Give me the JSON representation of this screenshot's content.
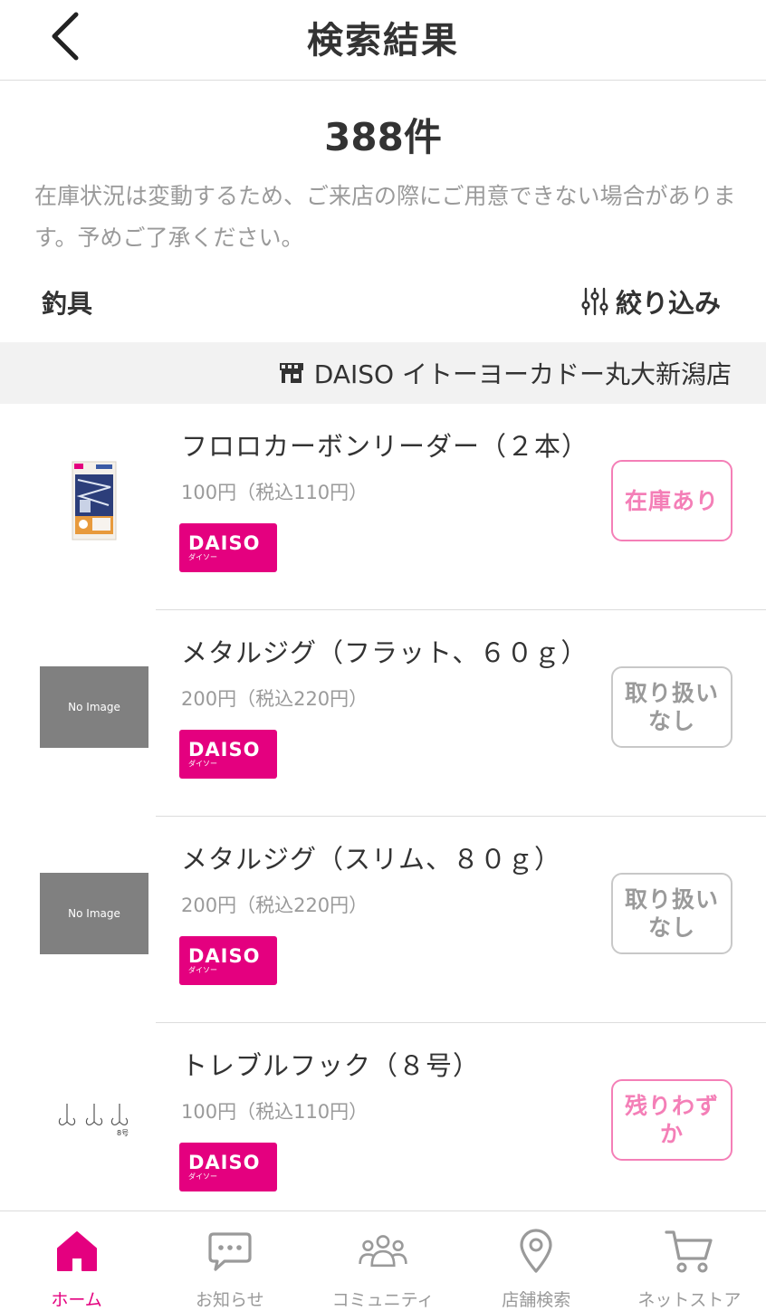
{
  "header": {
    "title": "検索結果"
  },
  "result_count": "388件",
  "notice": "在庫状況は変動するため、ご来店の際にご用意できない場合があります。予めご了承ください。",
  "category": "釣具",
  "filter_label": "絞り込み",
  "store": {
    "name": "DAISO イトーヨーカドー丸大新潟店",
    "icon": "store-icon"
  },
  "brand": {
    "text": "DAISO",
    "sub": "ダイソー",
    "color": "#e4007f"
  },
  "no_image_text": "No Image",
  "items": [
    {
      "name": "フロロカーボンリーダー（２本）",
      "price": "100円（税込110円）",
      "stock": "在庫あり",
      "stock_style": "pink"
    },
    {
      "name": "メタルジグ（フラット、６０ｇ）",
      "price": "200円（税込220円）",
      "stock": "取り扱いなし",
      "stock_style": "gray"
    },
    {
      "name": "メタルジグ（スリム、８０ｇ）",
      "price": "200円（税込220円）",
      "stock": "取り扱いなし",
      "stock_style": "gray"
    },
    {
      "name": "トレブルフック（８号）",
      "price": "100円（税込110円）",
      "stock": "残りわずか",
      "stock_style": "pink",
      "thumb_label": "8号"
    }
  ],
  "nav": {
    "home": "ホーム",
    "news": "お知らせ",
    "community": "コミュニティ",
    "store_search": "店舗検索",
    "net_store": "ネットストア"
  },
  "colors": {
    "accent": "#e4007f",
    "stock_pink": "#f47fb7",
    "stock_gray": "#9a9a9a"
  }
}
